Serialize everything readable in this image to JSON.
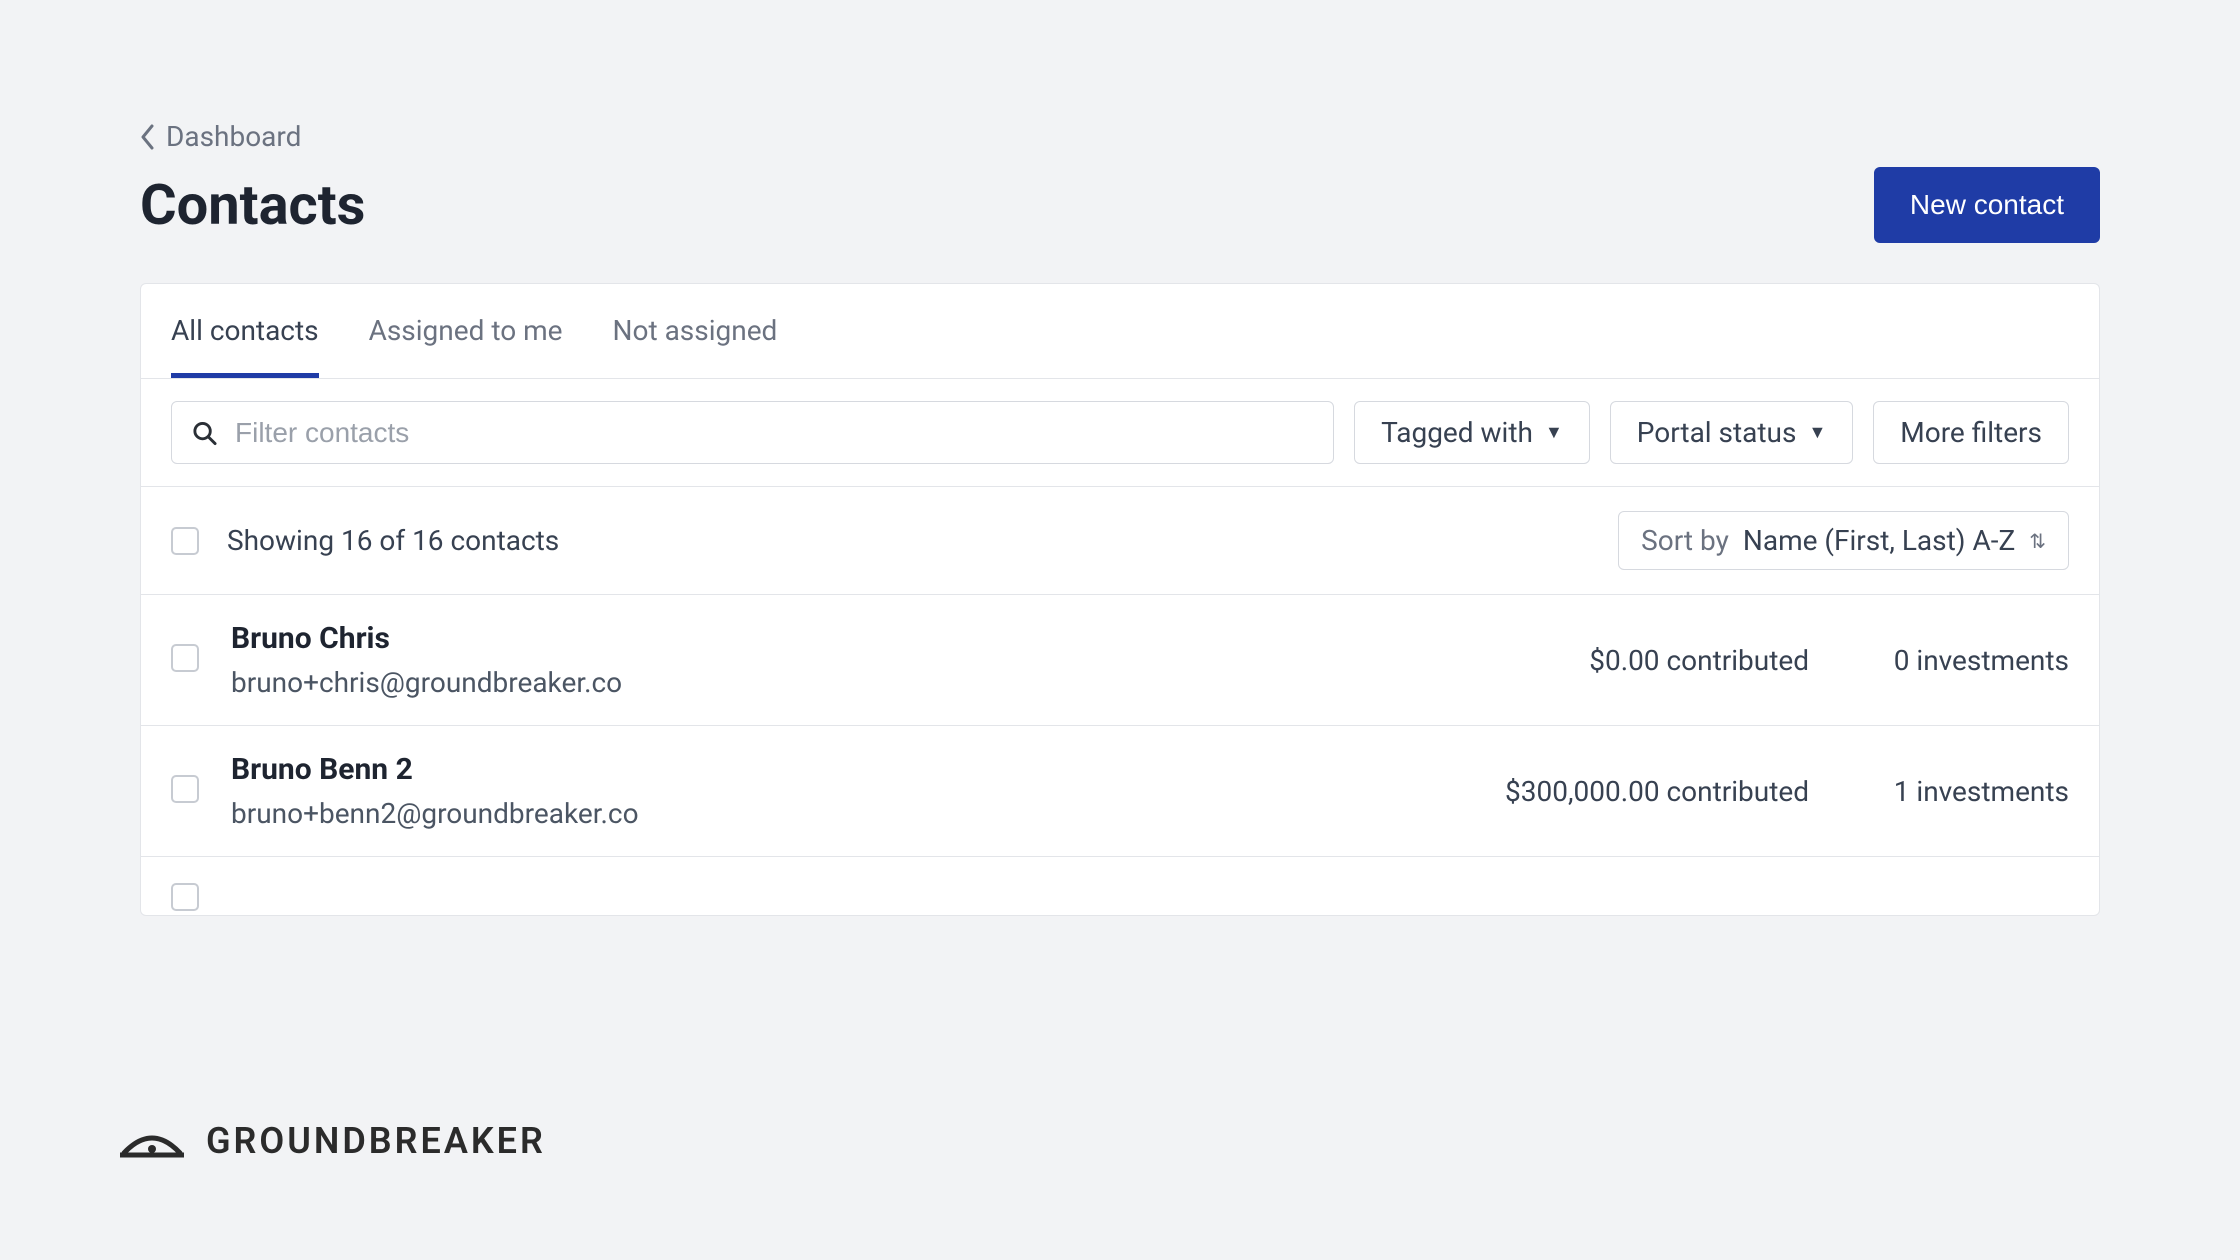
{
  "breadcrumb": {
    "label": "Dashboard"
  },
  "page": {
    "title": "Contacts"
  },
  "actions": {
    "new_contact": "New contact"
  },
  "tabs": [
    {
      "label": "All contacts",
      "active": true
    },
    {
      "label": "Assigned to me",
      "active": false
    },
    {
      "label": "Not assigned",
      "active": false
    }
  ],
  "filters": {
    "search_placeholder": "Filter contacts",
    "tagged_with": "Tagged with",
    "portal_status": "Portal status",
    "more_filters": "More filters"
  },
  "summary": {
    "showing": "Showing 16 of 16 contacts",
    "sort_prefix": "Sort by",
    "sort_value": "Name (First, Last) A-Z"
  },
  "rows": [
    {
      "name": "Bruno Chris",
      "email": "bruno+chris@groundbreaker.co",
      "contributed": "$0.00 contributed",
      "investments": "0 investments"
    },
    {
      "name": "Bruno Benn 2",
      "email": "bruno+benn2@groundbreaker.co",
      "contributed": "$300,000.00 contributed",
      "investments": "1 investments"
    }
  ],
  "brand": {
    "name": "GROUNDBREAKER"
  }
}
